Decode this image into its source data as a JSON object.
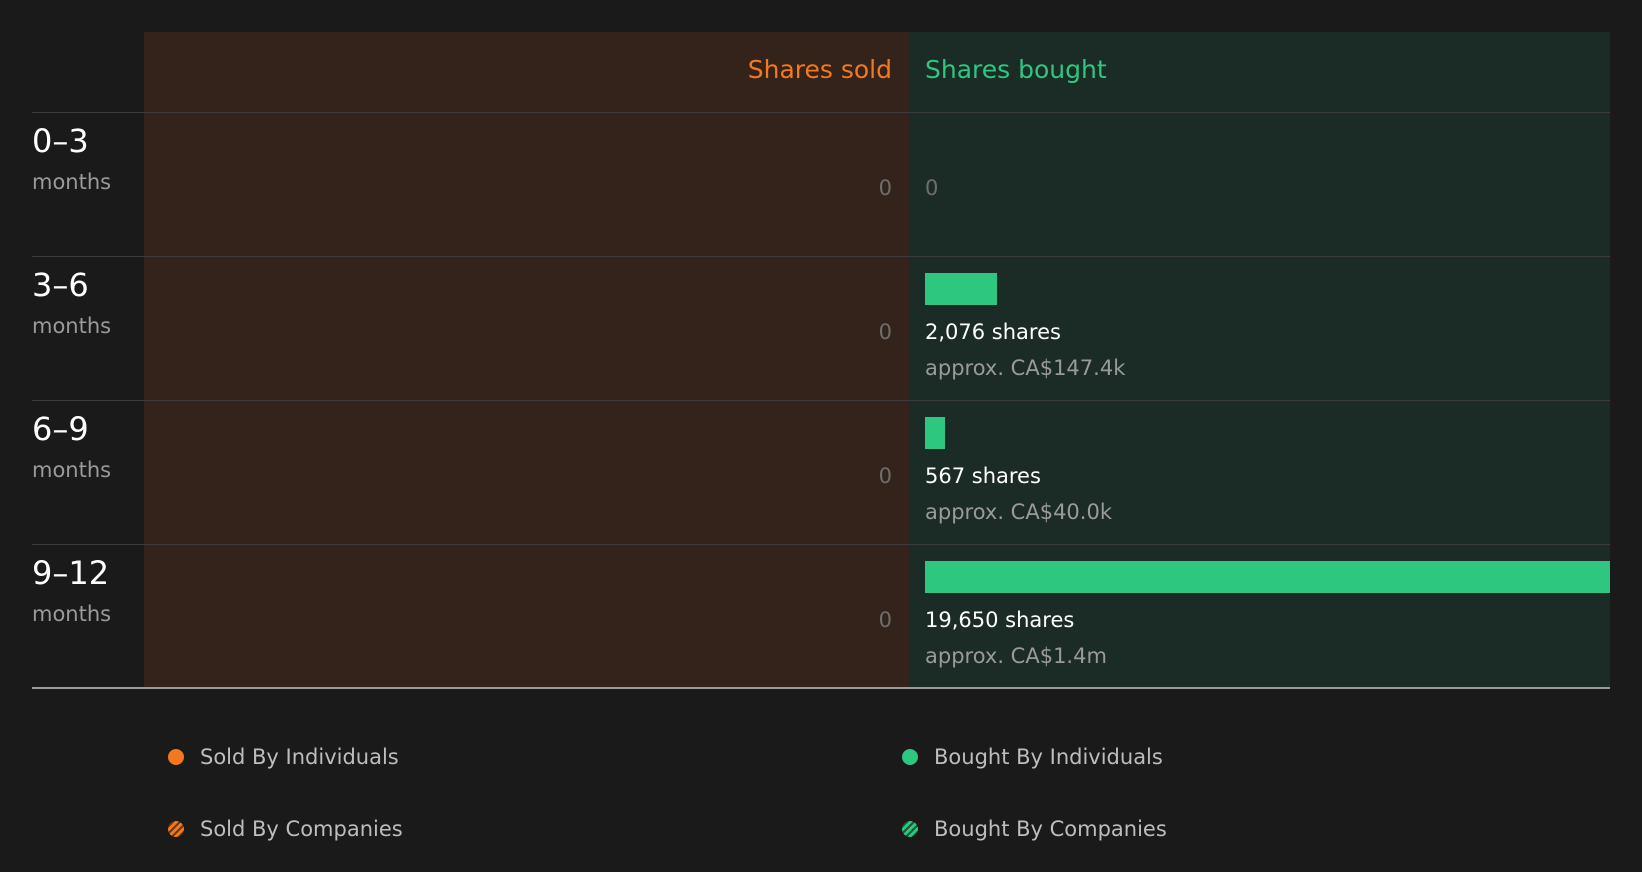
{
  "colors": {
    "sold": "#f5781e",
    "bought": "#2dc77f",
    "sold_bg": "#33231b",
    "bought_bg": "#1b2b25",
    "sold_stripe": "#6b3a14",
    "bought_stripe": "#145a3a"
  },
  "chart_data": {
    "type": "bar",
    "orientation": "horizontal",
    "header_left": "Shares sold",
    "header_right": "Shares bought",
    "rows": [
      {
        "range": "0–3",
        "unit": "months",
        "sold_label": "0",
        "sold": 0,
        "bought": 0,
        "bought_label": "0",
        "shares_text": "",
        "approx_text": ""
      },
      {
        "range": "3–6",
        "unit": "months",
        "sold_label": "0",
        "sold": 0,
        "bought": 2076,
        "bought_label": "",
        "shares_text": "2,076 shares",
        "approx_text": "approx. CA$147.4k"
      },
      {
        "range": "6–9",
        "unit": "months",
        "sold_label": "0",
        "sold": 0,
        "bought": 567,
        "bought_label": "",
        "shares_text": "567 shares",
        "approx_text": "approx. CA$40.0k"
      },
      {
        "range": "9–12",
        "unit": "months",
        "sold_label": "0",
        "sold": 0,
        "bought": 19650,
        "bought_label": "",
        "shares_text": "19,650 shares",
        "approx_text": "approx. CA$1.4m"
      }
    ],
    "bought_max": 19650,
    "legend": [
      {
        "label": "Sold By Individuals",
        "style": "solid",
        "side": "sold"
      },
      {
        "label": "Bought By Individuals",
        "style": "solid",
        "side": "bought"
      },
      {
        "label": "Sold By Companies",
        "style": "striped",
        "side": "sold"
      },
      {
        "label": "Bought By Companies",
        "style": "striped",
        "side": "bought"
      }
    ]
  }
}
